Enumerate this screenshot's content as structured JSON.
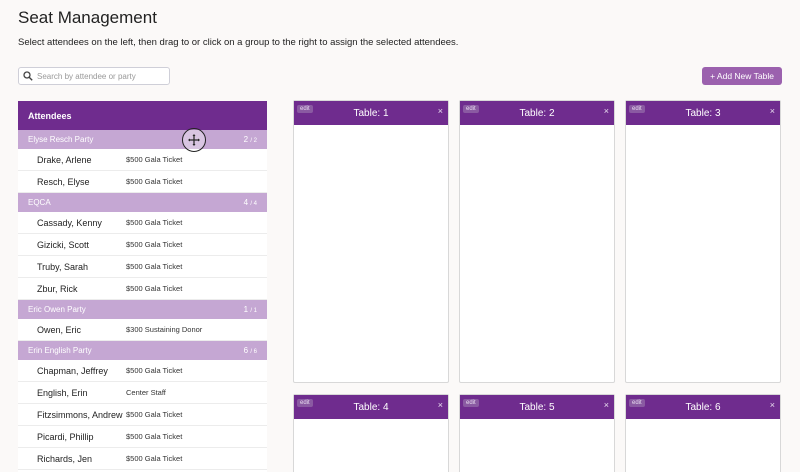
{
  "page": {
    "title": "Seat Management",
    "instructions": "Select attendees on the left, then drag to or click on a group to the right to assign the selected attendees."
  },
  "search": {
    "placeholder": "Search by attendee or party",
    "value": ""
  },
  "add_table_label": "+ Add New Table",
  "attendees_header": "Attendees",
  "groups": [
    {
      "name": "Elyse Resch Party",
      "count": "2",
      "total": "/ 2",
      "attendees": [
        {
          "name": "Drake, Arlene",
          "ticket": "$500 Gala Ticket"
        },
        {
          "name": "Resch, Elyse",
          "ticket": "$500 Gala Ticket"
        }
      ]
    },
    {
      "name": "EQCA",
      "count": "4",
      "total": "/ 4",
      "attendees": [
        {
          "name": "Cassady, Kenny",
          "ticket": "$500 Gala Ticket"
        },
        {
          "name": "Gizicki, Scott",
          "ticket": "$500 Gala Ticket"
        },
        {
          "name": "Truby, Sarah",
          "ticket": "$500 Gala Ticket"
        },
        {
          "name": "Zbur, Rick",
          "ticket": "$500 Gala Ticket"
        }
      ]
    },
    {
      "name": "Eric Owen Party",
      "count": "1",
      "total": "/ 1",
      "attendees": [
        {
          "name": "Owen, Eric",
          "ticket": "$300 Sustaining Donor"
        }
      ]
    },
    {
      "name": "Erin English Party",
      "count": "6",
      "total": "/ 6",
      "attendees": [
        {
          "name": "Chapman, Jeffrey",
          "ticket": "$500 Gala Ticket"
        },
        {
          "name": "English, Erin",
          "ticket": "Center Staff"
        },
        {
          "name": "Fitzsimmons, Andrew",
          "ticket": "$500 Gala Ticket"
        },
        {
          "name": "Picardi, Phillip",
          "ticket": "$500 Gala Ticket"
        },
        {
          "name": "Richards, Jen",
          "ticket": "$500 Gala Ticket"
        }
      ]
    }
  ],
  "tables": [
    {
      "edit": "edit",
      "title": "Table: 1",
      "close": "×"
    },
    {
      "edit": "edit",
      "title": "Table: 2",
      "close": "×"
    },
    {
      "edit": "edit",
      "title": "Table: 3",
      "close": "×"
    },
    {
      "edit": "edit",
      "title": "Table: 4",
      "close": "×"
    },
    {
      "edit": "edit",
      "title": "Table: 5",
      "close": "×"
    },
    {
      "edit": "edit",
      "title": "Table: 6",
      "close": "×"
    }
  ],
  "colors": {
    "header_purple": "#6f2c8e",
    "group_lavender": "#c5a7d3",
    "button_purple": "#9b61ae",
    "background": "#fbf9f8"
  },
  "icons": {
    "search": "search-icon",
    "drag_cursor": "move-cursor-icon"
  }
}
